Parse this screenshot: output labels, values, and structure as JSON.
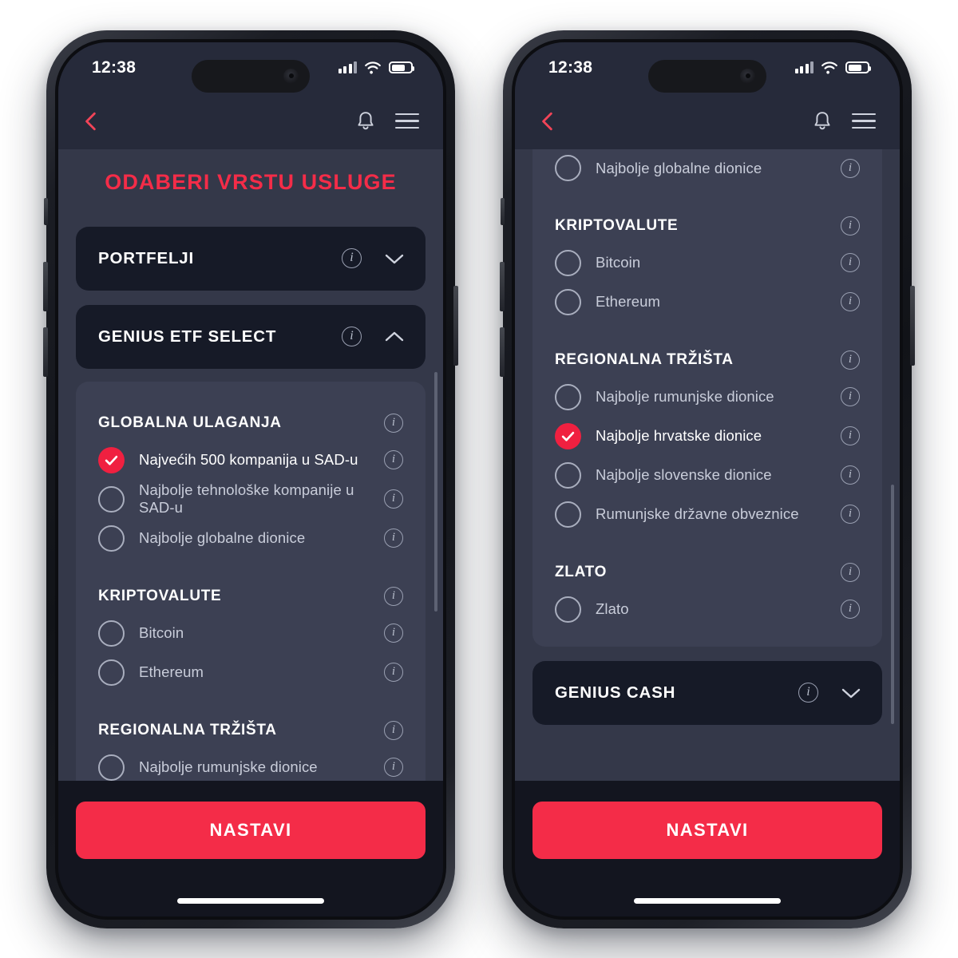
{
  "status_bar": {
    "time": "12:38",
    "signal_icon": "cellular-bars-icon",
    "wifi_icon": "wifi-icon",
    "battery_icon": "battery-icon"
  },
  "app_bar": {
    "back_icon": "back-chevron-icon",
    "notifications_icon": "bell-icon",
    "menu_icon": "hamburger-menu-icon"
  },
  "colors": {
    "accent": "#f42c48",
    "selected_fill": "#f02040",
    "panel": "#3c4053",
    "card": "#161a27",
    "page_bg": "#343849",
    "footer_bg": "#13151f"
  },
  "left_phone": {
    "page_title": "ODABERI VRSTU USLUGE",
    "accordions": [
      {
        "label": "PORTFELJI",
        "info_icon": "info-icon",
        "chevron": "chevron-down-icon",
        "expanded": false
      },
      {
        "label": "GENIUS ETF SELECT",
        "info_icon": "info-icon",
        "chevron": "chevron-up-icon",
        "expanded": true
      }
    ],
    "groups": [
      {
        "title": "GLOBALNA ULAGANJA",
        "info_icon": "info-icon",
        "options": [
          {
            "label": "Najvećih 500 kompanija u SAD-u",
            "selected": true,
            "info_icon": "info-icon"
          },
          {
            "label": "Najbolje tehnološke kompanije u SAD-u",
            "selected": false,
            "info_icon": "info-icon"
          },
          {
            "label": "Najbolje globalne dionice",
            "selected": false,
            "info_icon": "info-icon"
          }
        ]
      },
      {
        "title": "KRIPTOVALUTE",
        "info_icon": "info-icon",
        "options": [
          {
            "label": "Bitcoin",
            "selected": false,
            "info_icon": "info-icon"
          },
          {
            "label": "Ethereum",
            "selected": false,
            "info_icon": "info-icon"
          }
        ]
      },
      {
        "title": "REGIONALNA TRŽIŠTA",
        "info_icon": "info-icon",
        "options": [
          {
            "label": "Najbolje rumunjske dionice",
            "selected": false,
            "info_icon": "info-icon"
          }
        ]
      }
    ],
    "cta_label": "NASTAVI"
  },
  "right_phone": {
    "partial_top_option": {
      "label": "Najbolje globalne dionice",
      "selected": false,
      "info_icon": "info-icon"
    },
    "groups": [
      {
        "title": "KRIPTOVALUTE",
        "info_icon": "info-icon",
        "options": [
          {
            "label": "Bitcoin",
            "selected": false,
            "info_icon": "info-icon"
          },
          {
            "label": "Ethereum",
            "selected": false,
            "info_icon": "info-icon"
          }
        ]
      },
      {
        "title": "REGIONALNA TRŽIŠTA",
        "info_icon": "info-icon",
        "options": [
          {
            "label": "Najbolje rumunjske dionice",
            "selected": false,
            "info_icon": "info-icon"
          },
          {
            "label": "Najbolje hrvatske dionice",
            "selected": true,
            "info_icon": "info-icon"
          },
          {
            "label": "Najbolje slovenske dionice",
            "selected": false,
            "info_icon": "info-icon"
          },
          {
            "label": "Rumunjske državne obveznice",
            "selected": false,
            "info_icon": "info-icon"
          }
        ]
      },
      {
        "title": "ZLATO",
        "info_icon": "info-icon",
        "options": [
          {
            "label": "Zlato",
            "selected": false,
            "info_icon": "info-icon"
          }
        ]
      }
    ],
    "accordions": [
      {
        "label": "GENIUS CASH",
        "info_icon": "info-icon",
        "chevron": "chevron-down-icon",
        "expanded": false
      }
    ],
    "cta_label": "NASTAVI"
  },
  "info_glyph": "i"
}
